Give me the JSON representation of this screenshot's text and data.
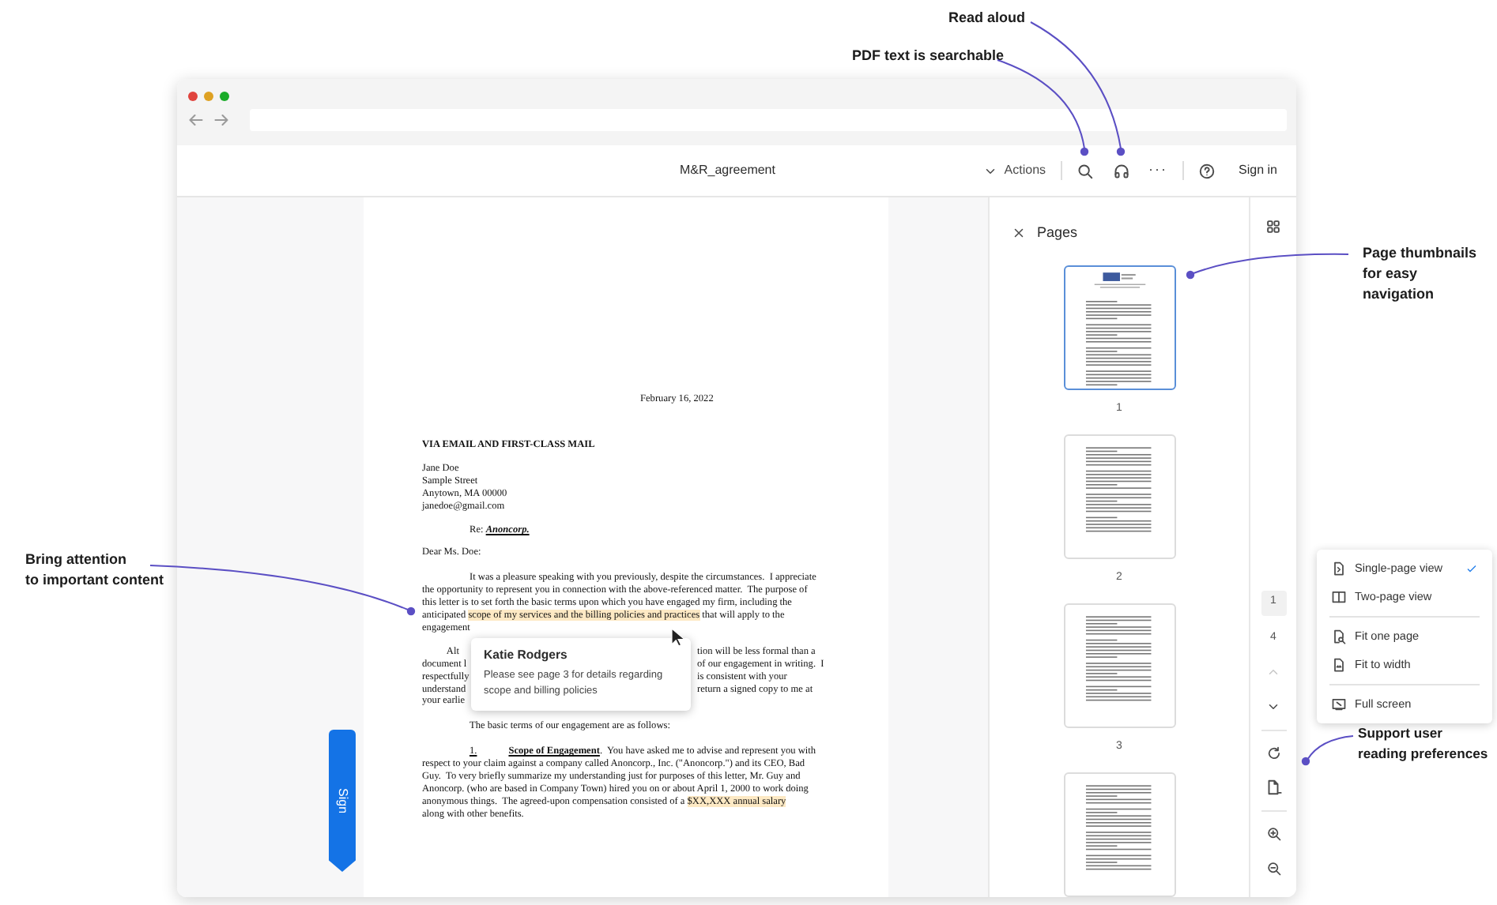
{
  "callouts": [
    {
      "lines": [
        "Read aloud"
      ]
    },
    {
      "lines": [
        "PDF text is searchable"
      ]
    },
    {
      "lines": [
        "Page thumbnails",
        "for easy",
        "navigation"
      ]
    },
    {
      "lines": [
        "Bring attention",
        "to important content"
      ]
    },
    {
      "lines": [
        "Support user",
        "reading preferences"
      ]
    }
  ],
  "toolbar": {
    "title": "M&R_agreement",
    "actions": "Actions",
    "more": "···",
    "sign_in": "Sign in"
  },
  "document": {
    "blocks": [
      {
        "kind": "date",
        "lines": [
          [
            {
              "kind": "plain",
              "text": "February 16, 2022"
            }
          ]
        ]
      },
      {
        "kind": "heading",
        "lines": [
          [
            {
              "kind": "plain",
              "text": "VIA EMAIL AND FIRST-CLASS MAIL"
            }
          ]
        ]
      },
      {
        "kind": "address",
        "lines": [
          [
            {
              "kind": "plain",
              "text": "Jane Doe"
            }
          ],
          [
            {
              "kind": "plain",
              "text": "Sample Street"
            }
          ],
          [
            {
              "kind": "plain",
              "text": "Anytown, MA 00000"
            }
          ],
          [
            {
              "kind": "plain",
              "text": "janedoe@gmail.com"
            }
          ]
        ]
      },
      {
        "kind": "reference",
        "lines": [
          [
            {
              "kind": "plain",
              "text": "Re: "
            },
            {
              "kind": "emphasis",
              "text": "Anoncorp."
            }
          ]
        ]
      },
      {
        "kind": "salutation",
        "lines": [
          [
            {
              "kind": "plain",
              "text": "Dear Ms. Doe:"
            }
          ]
        ]
      },
      {
        "kind": "paragraph",
        "lines": [
          [
            {
              "kind": "plain",
              "text": "It was a pleasure speaking with you previously, despite the circumstances.  I appreciate"
            }
          ],
          [
            {
              "kind": "plain",
              "text": "the opportunity to represent you in connection with the above-referenced matter.  The purpose of"
            }
          ],
          [
            {
              "kind": "plain",
              "text": "this letter is to set forth the basic terms upon which you have engaged my firm, including the"
            }
          ],
          [
            {
              "kind": "plain",
              "text": "anticipated "
            },
            {
              "kind": "highlighted",
              "text": "scope of my services and the billing policies and practices"
            },
            {
              "kind": "plain",
              "text": " that will apply to the"
            }
          ],
          [
            {
              "kind": "plain",
              "text": "engagement"
            }
          ]
        ]
      },
      {
        "kind": "split",
        "left": [
          "Alt",
          "document l",
          "respectfully",
          "understand",
          "your earlie"
        ],
        "right": [
          "tion will be less formal than a",
          "of our engagement in writing.  I",
          "is consistent with your",
          "return a signed copy to me at"
        ]
      },
      {
        "kind": "paragraph",
        "lines": [
          [
            {
              "kind": "plain",
              "text": "The basic terms of our engagement are as follows:"
            }
          ]
        ]
      },
      {
        "kind": "paragraph",
        "lines": [
          [
            {
              "kind": "number",
              "text": "1."
            },
            {
              "kind": "heading",
              "text": "Scope of Engagement"
            },
            {
              "kind": "plain",
              "text": ".  You have asked me to advise and represent you with"
            }
          ],
          [
            {
              "kind": "plain",
              "text": "respect to your claim against a company called Anoncorp., Inc. (\"Anoncorp.\") and its CEO, Bad"
            }
          ],
          [
            {
              "kind": "plain",
              "text": "Guy.  To very briefly summarize my understanding just for purposes of this letter, Mr. Guy and"
            }
          ],
          [
            {
              "kind": "plain",
              "text": "Anoncorp. (who are based in Company Town) hired you on or about April 1, 2000 to work doing"
            }
          ],
          [
            {
              "kind": "plain",
              "text": "anonymous things.  The agreed-upon compensation consisted of a "
            },
            {
              "kind": "highlighted",
              "text": "$XX,XXX annual salary"
            }
          ],
          [
            {
              "kind": "plain",
              "text": "along with other benefits."
            }
          ]
        ]
      }
    ]
  },
  "comment": {
    "author": "Katie Rodgers",
    "text": "Please see page 3 for details regarding scope and billing policies"
  },
  "sign_tab": {
    "label": "Sign"
  },
  "pages_panel": {
    "title": "Pages",
    "thumbnails": [
      {
        "number": "1",
        "selected": true,
        "kind": "letterhead"
      },
      {
        "number": "2",
        "selected": false,
        "kind": "text"
      },
      {
        "number": "3",
        "selected": false,
        "kind": "text"
      },
      {
        "selected": false,
        "kind": "text"
      }
    ]
  },
  "page_rail": {
    "current_page": "1",
    "total_pages": "4",
    "previous_disabled": true
  },
  "view_menu": {
    "groups": [
      [
        {
          "label": "Single-page view",
          "checked": true
        },
        {
          "label": "Two-page view",
          "checked": false
        }
      ],
      [
        {
          "label": "Fit one page",
          "checked": false
        },
        {
          "label": "Fit to width",
          "checked": false
        }
      ],
      [
        {
          "label": "Full screen",
          "checked": false
        }
      ]
    ]
  }
}
